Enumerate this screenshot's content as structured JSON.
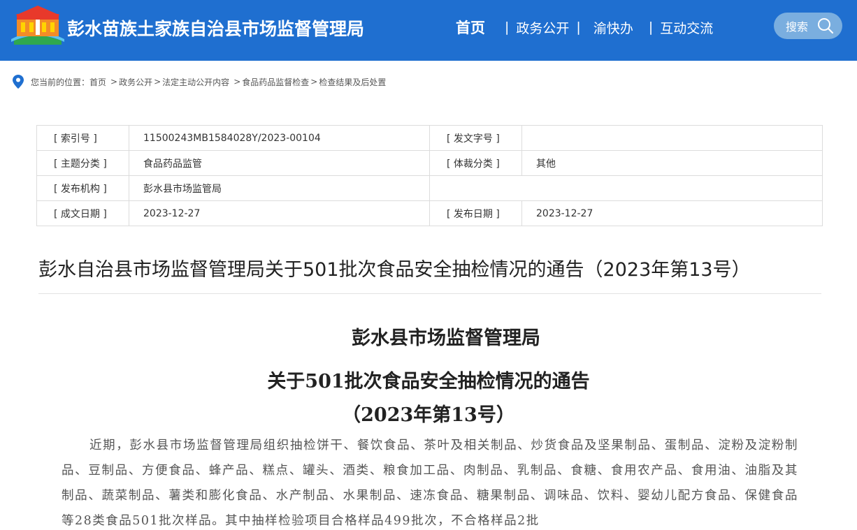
{
  "header": {
    "site_title": "彭水苗族土家族自治县市场监督管理局",
    "nav": [
      {
        "label": "首页",
        "active": true
      },
      {
        "label": "政务公开",
        "active": false
      },
      {
        "label": "渝快办",
        "active": false
      },
      {
        "label": "互动交流",
        "active": false
      }
    ],
    "search_label": "搜索"
  },
  "breadcrumb": {
    "prefix": "您当前的位置：",
    "items": [
      "首页",
      "政务公开",
      "法定主动公开内容",
      "食品药品监督检查",
      "检查结果及后处置"
    ],
    "separator": ">"
  },
  "info": {
    "rows": [
      {
        "l1": "[ 索引号 ]",
        "v1": "11500243MB1584028Y/2023-00104",
        "l2": "[ 发文字号 ]",
        "v2": ""
      },
      {
        "l1": "[ 主题分类 ]",
        "v1": "食品药品监管",
        "l2": "[ 体裁分类 ]",
        "v2": "其他"
      },
      {
        "l1": "[ 发布机构 ]",
        "v1": "彭水县市场监管局",
        "l2": "",
        "v2": ""
      },
      {
        "l1": "[ 成文日期 ]",
        "v1": "2023-12-27",
        "l2": "[ 发布日期 ]",
        "v2": "2023-12-27"
      }
    ]
  },
  "article": {
    "title": "彭水自治县市场监督管理局关于501批次食品安全抽检情况的通告（2023年第13号）",
    "sub1": "彭水县市场监督管理局",
    "sub2": "关于501批次食品安全抽检情况的通告",
    "sub3": "（2023年第13号）",
    "body": "近期，彭水县市场监督管理局组织抽检饼干、餐饮食品、茶叶及相关制品、炒货食品及坚果制品、蛋制品、淀粉及淀粉制品、豆制品、方便食品、蜂产品、糕点、罐头、酒类、粮食加工品、肉制品、乳制品、食糖、食用农产品、食用油、油脂及其制品、蔬菜制品、薯类和膨化食品、水产制品、水果制品、速冻食品、糖果制品、调味品、饮料、婴幼儿配方食品、保健食品等28类食品501批次样品。其中抽样检验项目合格样品499批次，不合格样品2批"
  },
  "colors": {
    "header_bg": "#1f6fd0",
    "search_bg": "#7aaedf",
    "pin": "#1f6fd0"
  }
}
